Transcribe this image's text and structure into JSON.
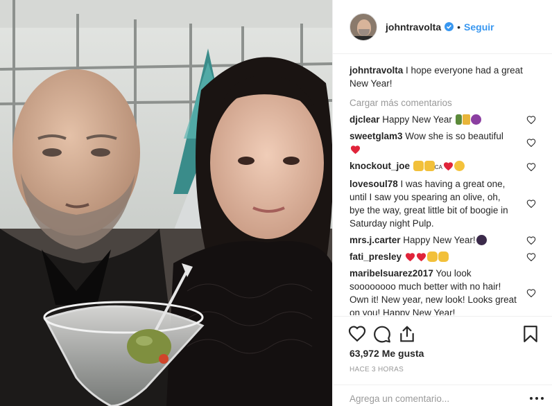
{
  "post": {
    "username": "johntravolta",
    "follow_label": "Seguir",
    "separator": "•",
    "caption": {
      "username": "johntravolta",
      "text": " I hope everyone had a great New Year!"
    },
    "load_more_label": "Cargar más comentarios",
    "comments": [
      {
        "username": "djclear",
        "text": " Happy New Year "
      },
      {
        "username": "sweetglam3",
        "text": " Wow she is so beautiful "
      },
      {
        "username": "knockout_joe",
        "text": " "
      },
      {
        "username": "lovesoul78",
        "text": " I was having a great one, until I saw you spearing an olive, oh, bye the way, great little bit of boogie in Saturday night Pulp."
      },
      {
        "username": "mrs.j.carter",
        "text": " Happy New Year!"
      },
      {
        "username": "fati_presley",
        "text": " "
      },
      {
        "username": "maribelsuarez2017",
        "text": " You look soooooooo much better with no hair! Own it! New year, new look! Looks great on you! Happy New Year!"
      }
    ],
    "likes_label": "63,972 Me gusta",
    "time_label": "HACE 3 HORAS",
    "add_comment_placeholder": "Agrega un comentario...",
    "emoji_small_text": "CA"
  },
  "colors": {
    "accent": "#3897f0",
    "text": "#262626",
    "muted": "#999999",
    "heart_red": "#ed4956",
    "border": "#efefef"
  },
  "icons": {
    "verified": "verified-badge-icon",
    "like": "heart-outline-icon",
    "comment": "comment-bubble-icon",
    "share": "share-icon",
    "save": "bookmark-icon",
    "options": "more-options-icon"
  }
}
